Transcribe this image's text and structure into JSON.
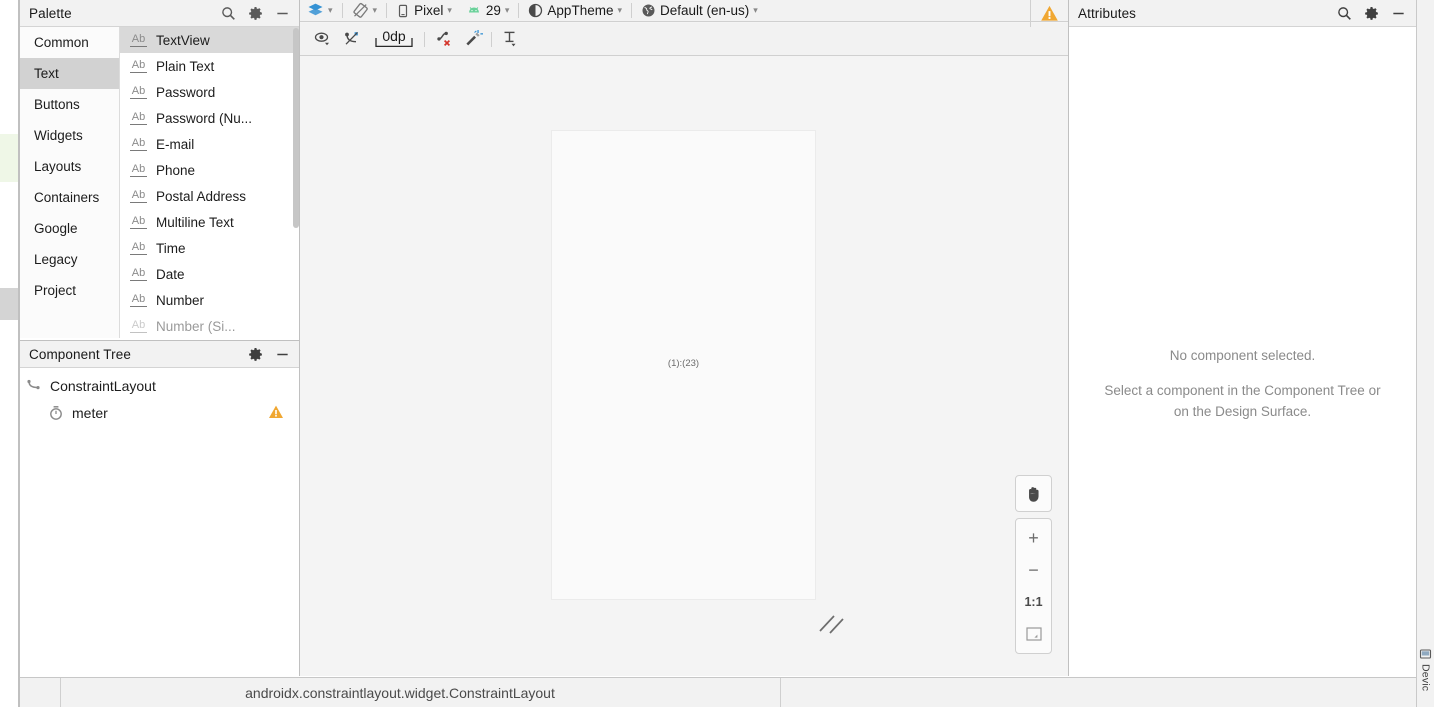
{
  "palette": {
    "title": "Palette",
    "actions": [
      {
        "name": "search-icon",
        "label": "Search"
      },
      {
        "name": "gear-icon",
        "label": "Settings"
      },
      {
        "name": "minimize-icon",
        "label": "Hide"
      }
    ],
    "categories": [
      {
        "label": "Common",
        "selected": false
      },
      {
        "label": "Text",
        "selected": true
      },
      {
        "label": "Buttons",
        "selected": false
      },
      {
        "label": "Widgets",
        "selected": false
      },
      {
        "label": "Layouts",
        "selected": false
      },
      {
        "label": "Containers",
        "selected": false
      },
      {
        "label": "Google",
        "selected": false
      },
      {
        "label": "Legacy",
        "selected": false
      },
      {
        "label": "Project",
        "selected": false
      }
    ],
    "item_icon": "Ab",
    "items": [
      {
        "label": "TextView",
        "selected": true
      },
      {
        "label": "Plain Text",
        "selected": false
      },
      {
        "label": "Password",
        "selected": false
      },
      {
        "label": "Password (Nu...",
        "selected": false
      },
      {
        "label": "E-mail",
        "selected": false
      },
      {
        "label": "Phone",
        "selected": false
      },
      {
        "label": "Postal Address",
        "selected": false
      },
      {
        "label": "Multiline Text",
        "selected": false
      },
      {
        "label": "Time",
        "selected": false
      },
      {
        "label": "Date",
        "selected": false
      },
      {
        "label": "Number",
        "selected": false
      },
      {
        "label": "Number (Si...",
        "selected": false
      }
    ]
  },
  "component_tree": {
    "title": "Component Tree",
    "actions": [
      {
        "name": "gear-icon",
        "label": "Settings"
      },
      {
        "name": "minimize-icon",
        "label": "Hide"
      }
    ],
    "nodes": [
      {
        "label": "ConstraintLayout",
        "icon": "constraint-layout-icon",
        "level": 0,
        "warning": false
      },
      {
        "label": "meter",
        "icon": "chronometer-icon",
        "level": 1,
        "warning": true
      }
    ]
  },
  "design_toolbar": {
    "mode_icon": "design-mode-icon",
    "orientation_icon": "rotate-orientation-icon",
    "device": {
      "icon": "phone-icon",
      "label": "Pixel"
    },
    "api": {
      "icon": "android-icon",
      "label": "29"
    },
    "theme": {
      "icon": "theme-icon",
      "label": "AppTheme"
    },
    "locale": {
      "icon": "globe-icon",
      "label": "Default (en-us)"
    },
    "warning_icon": "warning-icon"
  },
  "design_toolbar_2": {
    "buttons": [
      {
        "name": "view-options-icon",
        "label": "Show / Hide"
      },
      {
        "name": "clear-constraints-icon",
        "label": "Clear All Constraints"
      },
      {
        "name": "default-margin-button",
        "label": "0dp"
      },
      {
        "name": "delete-constraint-icon",
        "label": "Delete Constraint"
      },
      {
        "name": "infer-constraints-icon",
        "label": "Infer Constraints"
      },
      {
        "name": "align-baseline-icon",
        "label": "Guidelines"
      }
    ],
    "margin_value": "0dp"
  },
  "design_surface": {
    "device_preview_label": "(1):(23)",
    "resize_handle": "resize-handle-icon",
    "pan_button": {
      "name": "pan-hand-icon",
      "label": "Pan"
    },
    "zoom_controls": [
      {
        "name": "zoom-in-button",
        "label": "+"
      },
      {
        "name": "zoom-out-button",
        "label": "−"
      },
      {
        "name": "zoom-actual-size-button",
        "label": "1:1"
      },
      {
        "name": "zoom-to-fit-button",
        "label": "fit-screen-icon"
      }
    ]
  },
  "attributes": {
    "title": "Attributes",
    "actions": [
      {
        "name": "search-icon",
        "label": "Search"
      },
      {
        "name": "gear-icon",
        "label": "Settings"
      },
      {
        "name": "minimize-icon",
        "label": "Hide"
      }
    ],
    "empty_line1": "No component selected.",
    "empty_line2": "Select a component in the Component Tree or on the Design Surface."
  },
  "status_bar": {
    "text": "androidx.constraintlayout.widget.ConstraintLayout"
  },
  "right_tab": {
    "icon": "device-file-explorer-icon",
    "label": "Devic"
  },
  "colors": {
    "panel_bg": "#f2f2f2",
    "selection": "#d2d2d2",
    "warning": "#f0a732",
    "android_green": "#68d391",
    "accent_blue": "#3592d4",
    "surface": "#f4f4f4"
  }
}
